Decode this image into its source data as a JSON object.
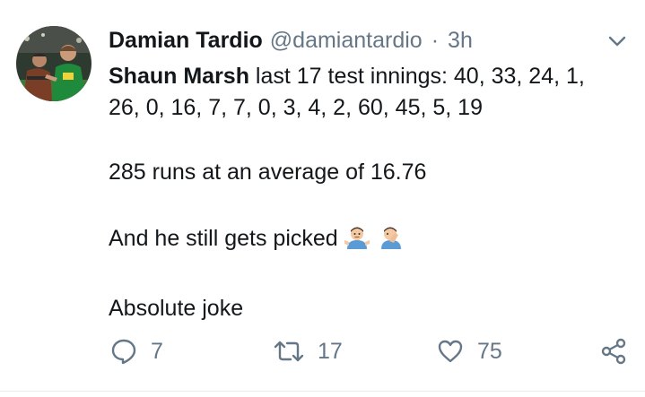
{
  "tweet": {
    "author": {
      "display_name": "Damian Tardio",
      "handle": "@damiantardio",
      "avatar_icon": "profile-photo"
    },
    "separator": "·",
    "timestamp": "3h",
    "text": {
      "mention": "Shaun Marsh",
      "line1_rest": " last 17 test innings: 40, 33, 24, 1,",
      "line2": "26, 0, 16, 7, 7, 0, 3, 4, 2, 60, 45, 5, 19",
      "line3": "285 runs at an average of 16.76",
      "line4": "And he still gets picked",
      "line4_emojis": [
        "man-shrugging-emoji",
        "man-facepalming-emoji"
      ],
      "line5": "Absolute joke"
    },
    "actions": {
      "reply_count": "7",
      "retweet_count": "17",
      "like_count": "75"
    },
    "icons": {
      "reply": "reply-icon",
      "retweet": "retweet-icon",
      "like": "heart-icon",
      "share": "share-icon",
      "menu": "chevron-down-icon"
    },
    "colors": {
      "text": "#14171a",
      "secondary": "#657786",
      "border": "#e6ecf0"
    }
  }
}
